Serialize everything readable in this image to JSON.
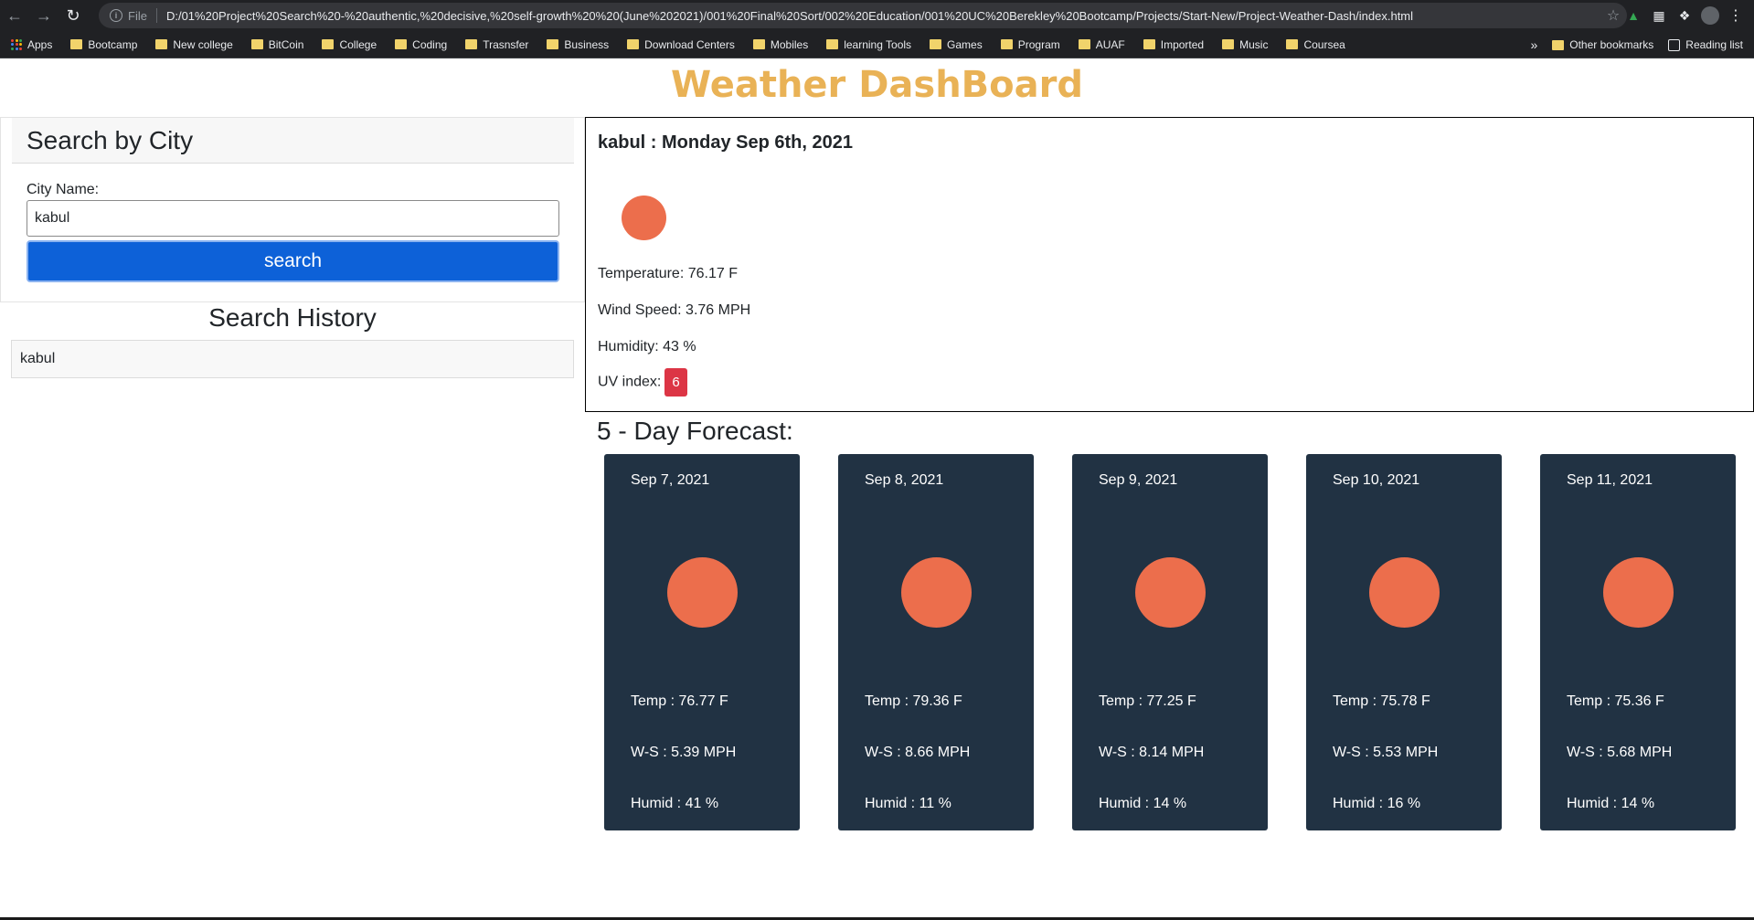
{
  "browser": {
    "url_scheme": "File",
    "url": "D:/01%20Project%20Search%20-%20authentic,%20decisive,%20self-growth%20%20(June%202021)/001%20Final%20Sort/002%20Education/001%20UC%20Berekley%20Bootcamp/Projects/Start-New/Project-Weather-Dash/index.html",
    "bookmarks": [
      "Apps",
      "Bootcamp",
      "New college",
      "BitCoin",
      "College",
      "Coding",
      "Trasnsfer",
      "Business",
      "Download Centers",
      "Mobiles",
      "learning Tools",
      "Games",
      "Program",
      "AUAF",
      "Imported",
      "Music",
      "Coursea"
    ],
    "more_bookmarks": "»",
    "other_bookmarks": "Other bookmarks",
    "reading_list": "Reading list"
  },
  "app": {
    "title": "Weather DashBoard",
    "accent": "#e9b256"
  },
  "search": {
    "title": "Search by City",
    "label": "City Name:",
    "value": "kabul",
    "button": "search"
  },
  "history": {
    "title": "Search History",
    "items": [
      "kabul"
    ]
  },
  "current": {
    "heading": "kabul : Monday Sep 6th, 2021",
    "temperature": "Temperature: 76.17 F",
    "wind": "Wind Speed: 3.76 MPH",
    "humidity": "Humidity: 43 %",
    "uv_label": "UV index:",
    "uv_value": "6",
    "icon": "sun-icon"
  },
  "forecast": {
    "title": "5 - Day Forecast:",
    "days": [
      {
        "date": "Sep 7, 2021",
        "temp": "Temp : 76.77 F",
        "ws": "W-S : 5.39 MPH",
        "humid": "Humid : 41 %"
      },
      {
        "date": "Sep 8, 2021",
        "temp": "Temp : 79.36 F",
        "ws": "W-S : 8.66 MPH",
        "humid": "Humid : 11 %"
      },
      {
        "date": "Sep 9, 2021",
        "temp": "Temp : 77.25 F",
        "ws": "W-S : 8.14 MPH",
        "humid": "Humid : 14 %"
      },
      {
        "date": "Sep 10, 2021",
        "temp": "Temp : 75.78 F",
        "ws": "W-S : 5.53 MPH",
        "humid": "Humid : 16 %"
      },
      {
        "date": "Sep 11, 2021",
        "temp": "Temp : 75.36 F",
        "ws": "W-S : 5.68 MPH",
        "humid": "Humid : 14 %"
      }
    ]
  },
  "colors": {
    "sun": "#ec6e4c",
    "card": "#213243",
    "button": "#0d61d8",
    "uv": "#dc3545"
  }
}
